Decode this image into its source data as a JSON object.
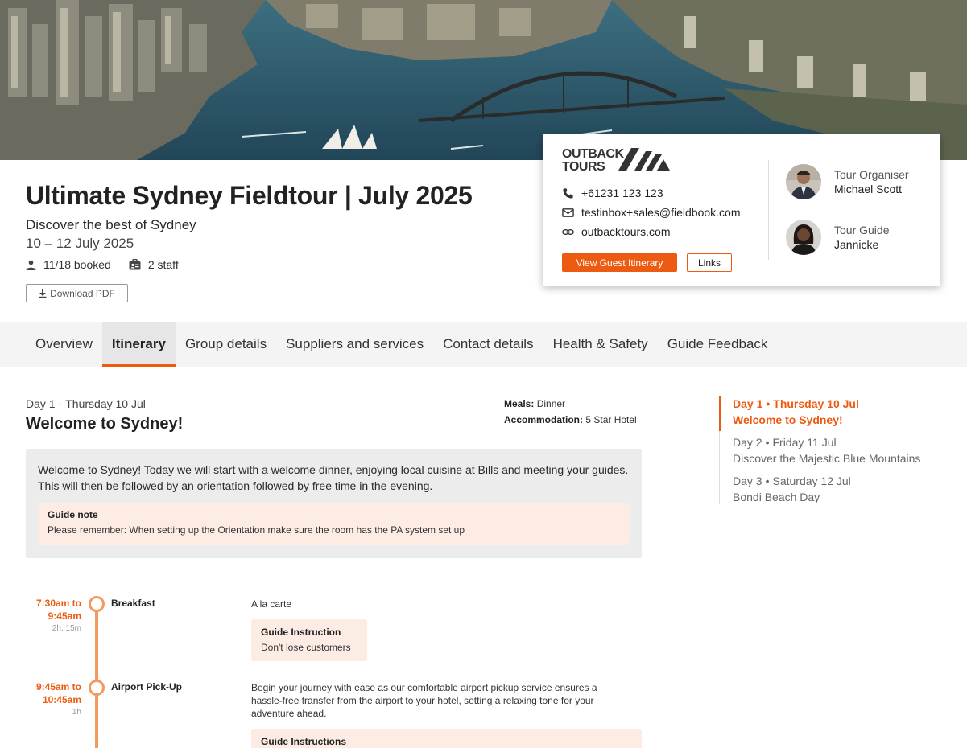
{
  "tour": {
    "title": "Ultimate Sydney Fieldtour | July 2025",
    "subtitle": "Discover the best of Sydney",
    "dates": "10 – 12 July 2025",
    "booked": "11/18 booked",
    "staff": "2 staff",
    "download_label": "Download PDF"
  },
  "contact": {
    "phone": "+61231 123 123",
    "email": "testinbox+sales@fieldbook.com",
    "website": "outbacktours.com",
    "view_itinerary_label": "View Guest Itinerary",
    "links_label": "Links",
    "logo_text": "OUTBACK TOURS",
    "people": [
      {
        "role": "Tour Organiser",
        "name": "Michael Scott"
      },
      {
        "role": "Tour Guide",
        "name": "Jannicke"
      }
    ]
  },
  "tabs": [
    {
      "label": "Overview"
    },
    {
      "label": "Itinerary",
      "active": true
    },
    {
      "label": "Group details"
    },
    {
      "label": "Suppliers and services"
    },
    {
      "label": "Contact details"
    },
    {
      "label": "Health & Safety"
    },
    {
      "label": "Guide Feedback"
    }
  ],
  "day": {
    "number": "Day 1",
    "date": "Thursday 10 Jul",
    "title": "Welcome to Sydney!",
    "meals_label": "Meals:",
    "meals_value": "Dinner",
    "accommodation_label": "Accommodation:",
    "accommodation_value": "5 Star Hotel",
    "summary": "Welcome to Sydney! Today we will start with a welcome dinner, enjoying local cuisine at Bills and meeting your guides. This will then be followed by an orientation followed by free time in the evening.",
    "guide_note_title": "Guide note",
    "guide_note_text": "Please remember: When setting up the Orientation make sure the room has the PA system set up"
  },
  "timeline": [
    {
      "time_start": "7:30am to",
      "time_end": "9:45am",
      "duration": "2h, 15m",
      "name": "Breakfast",
      "description": "A la carte",
      "instruction_title": "Guide Instruction",
      "instruction_text": "Don't lose customers"
    },
    {
      "time_start": "9:45am to",
      "time_end": "10:45am",
      "duration": "1h",
      "name": "Airport Pick-Up",
      "description": "Begin your journey with ease as our comfortable airport pickup service ensures a hassle-free transfer from the airport to your hotel, setting a relaxing tone for your adventure ahead.",
      "instruction_title": "Guide Instructions"
    }
  ],
  "side_nav": [
    {
      "day": "Day 1",
      "date": "Thursday 10 Jul",
      "title": "Welcome to Sydney!",
      "active": true
    },
    {
      "day": "Day 2",
      "date": "Friday 11 Jul",
      "title": "Discover the Majestic Blue Mountains"
    },
    {
      "day": "Day 3",
      "date": "Saturday 12 Jul",
      "title": "Bondi Beach Day"
    }
  ],
  "colors": {
    "accent": "#ed5b12",
    "timeline": "#f59a5f",
    "note_bg": "#fdece4",
    "summary_bg": "#ececec"
  }
}
